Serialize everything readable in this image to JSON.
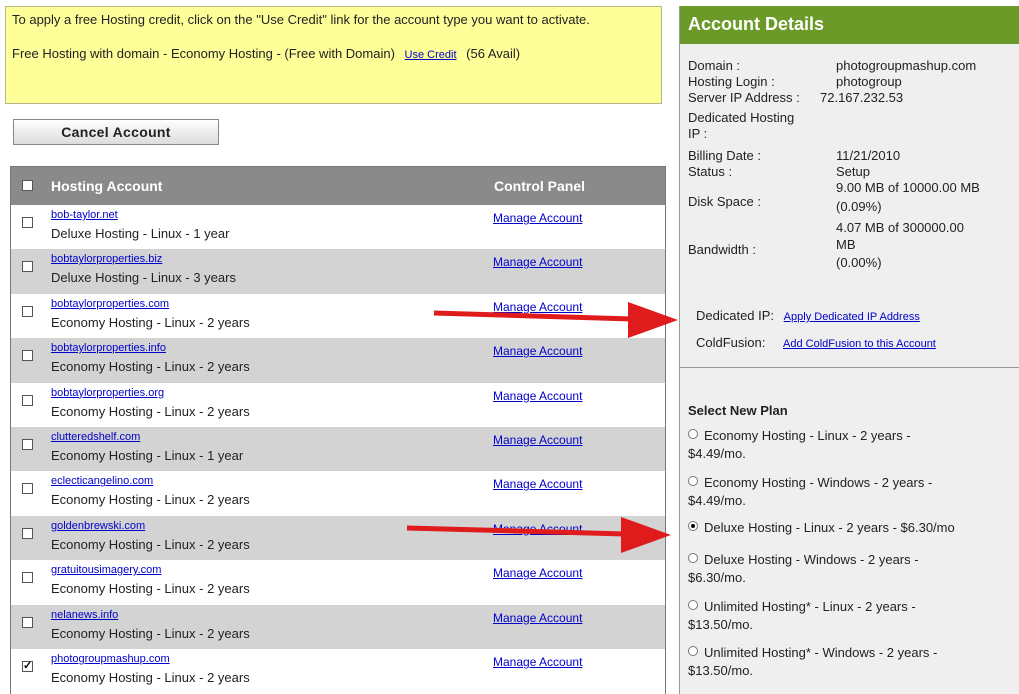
{
  "notice": {
    "line1": "To apply a free Hosting credit, click on the \"Use Credit\" link for the account type you want to activate.",
    "line2_text": "Free Hosting with domain - Economy Hosting - (Free with Domain)",
    "link": "Use Credit",
    "avail": "(56 Avail)"
  },
  "cancel_label": "Cancel Account",
  "table": {
    "col_account": "Hosting Account",
    "col_panel": "Control Panel",
    "rows": [
      {
        "domain": "bob-taylor.net",
        "plan": "Deluxe Hosting - Linux - 1 year",
        "manage": "Manage Account",
        "checked": false
      },
      {
        "domain": "bobtaylorproperties.biz",
        "plan": "Deluxe Hosting - Linux - 3 years",
        "manage": "Manage Account",
        "checked": false
      },
      {
        "domain": "bobtaylorproperties.com",
        "plan": "Economy Hosting - Linux - 2 years",
        "manage": "Manage Account",
        "checked": false
      },
      {
        "domain": "bobtaylorproperties.info",
        "plan": "Economy Hosting - Linux - 2 years",
        "manage": "Manage Account",
        "checked": false
      },
      {
        "domain": "bobtaylorproperties.org",
        "plan": "Economy Hosting - Linux - 2 years",
        "manage": "Manage Account",
        "checked": false
      },
      {
        "domain": "clutteredshelf.com",
        "plan": "Economy Hosting - Linux - 1 year",
        "manage": "Manage Account",
        "checked": false
      },
      {
        "domain": "eclecticangelino.com",
        "plan": "Economy Hosting - Linux - 2 years",
        "manage": "Manage Account",
        "checked": false
      },
      {
        "domain": "goldenbrewski.com",
        "plan": "Economy Hosting - Linux - 2 years",
        "manage": "Manage Account",
        "checked": false
      },
      {
        "domain": "gratuitousimagery.com",
        "plan": "Economy Hosting - Linux - 2 years",
        "manage": "Manage Account",
        "checked": false
      },
      {
        "domain": "nelanews.info",
        "plan": "Economy Hosting - Linux - 2 years",
        "manage": "Manage Account",
        "checked": false
      },
      {
        "domain": "photogroupmashup.com",
        "plan": "Economy Hosting - Linux - 2 years",
        "manage": "Manage Account",
        "checked": true
      }
    ]
  },
  "details": {
    "title": "Account Details",
    "domain_label": "Domain :",
    "domain_value": "photogroupmashup.com",
    "login_label": "Hosting Login :",
    "login_value": "photogroup",
    "ip_label": "Server IP Address :",
    "ip_value": "72.167.232.53",
    "dedicated_label1": "Dedicated Hosting",
    "dedicated_label2": "IP :",
    "billing_label": "Billing Date :",
    "billing_value": "11/21/2010",
    "status_label": "Status :",
    "status_value": "Setup",
    "disk_label": "Disk Space :",
    "disk_value1": "9.00 MB of 10000.00 MB",
    "disk_value2": "(0.09%)",
    "bw_label": "Bandwidth :",
    "bw_value1": "4.07 MB of 300000.00",
    "bw_value2": "MB",
    "bw_value3": "(0.00%)",
    "dedip_label": "Dedicated IP:",
    "dedip_link": "Apply Dedicated IP Address",
    "cf_label": "ColdFusion:",
    "cf_link": "Add ColdFusion to this Account",
    "select_title": "Select New Plan",
    "plans": [
      {
        "l1": "Economy Hosting - Linux - 2 years -",
        "l2": "$4.49/mo.",
        "selected": false
      },
      {
        "l1": "Economy Hosting - Windows - 2 years -",
        "l2": "$4.49/mo.",
        "selected": false
      },
      {
        "l1": "Deluxe Hosting - Linux - 2 years - $6.30/mo",
        "l2": "",
        "selected": true
      },
      {
        "l1": "Deluxe Hosting - Windows - 2 years -",
        "l2": "$6.30/mo.",
        "selected": false
      },
      {
        "l1": "Unlimited Hosting* - Linux - 2 years -",
        "l2": "$13.50/mo.",
        "selected": false
      },
      {
        "l1": "Unlimited Hosting* - Windows - 2 years -",
        "l2": "$13.50/mo.",
        "selected": false
      }
    ]
  },
  "colors": {
    "accent_green": "#6b9a29",
    "arrow_red": "#e01b1b",
    "notice_yellow": "#ffff99"
  }
}
